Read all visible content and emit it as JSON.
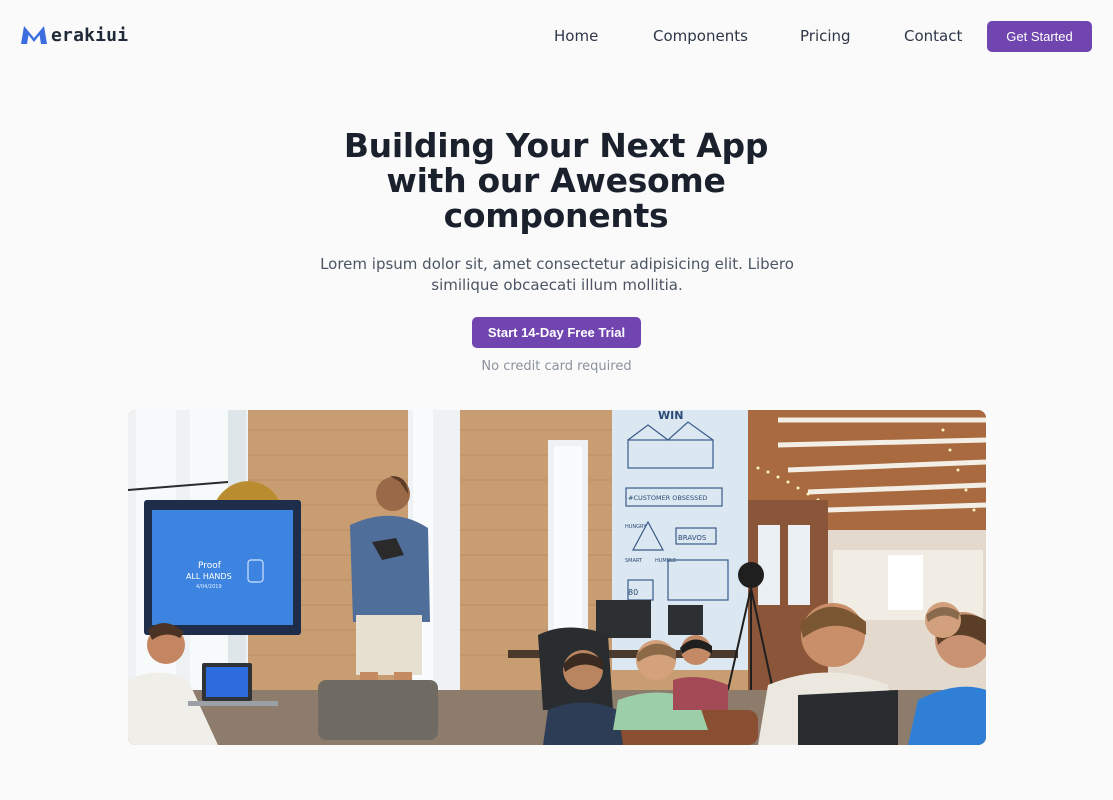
{
  "brand": {
    "name": "erakiui",
    "logo_icon": "m-logo-icon",
    "accent": "#7145b0",
    "logo_color": "#3b6fe0"
  },
  "nav": {
    "links": [
      "Home",
      "Components",
      "Pricing",
      "Contact"
    ],
    "cta": "Get Started"
  },
  "hero": {
    "title": "Building Your Next App with our Awesome components",
    "description": "Lorem ipsum dolor sit, amet consectetur adipisicing elit. Libero similique obcaecati illum mollitia.",
    "cta": "Start 14-Day Free Trial",
    "note": "No credit card required"
  },
  "image": {
    "screen_title": "Proof",
    "screen_subtitle": "ALL HANDS",
    "screen_date": "4/04/2019",
    "mural_top": "WIN",
    "mural_label": "#CUSTOMER OBSESSED",
    "mural_word1": "HUNGRY",
    "mural_word2": "BRAVOS",
    "mural_word3": "HUMBLE",
    "mural_word4": "SMART",
    "mural_number": "80"
  }
}
